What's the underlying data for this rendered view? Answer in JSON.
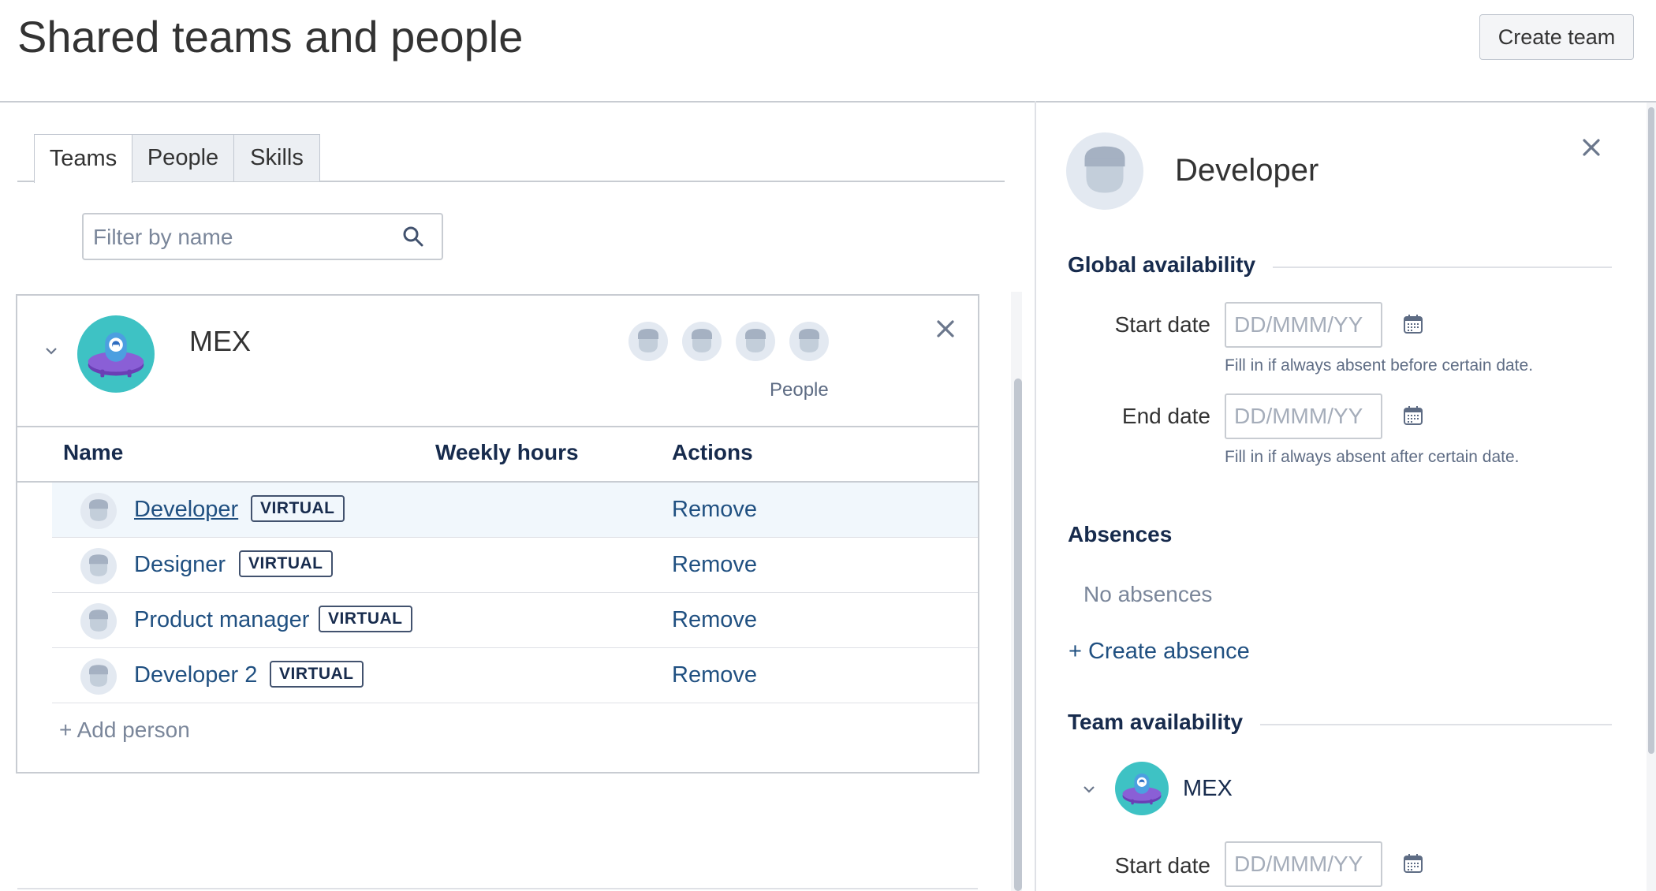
{
  "header": {
    "title": "Shared teams and people",
    "create_team_label": "Create team"
  },
  "tabs": [
    {
      "label": "Teams",
      "active": true
    },
    {
      "label": "People",
      "active": false
    },
    {
      "label": "Skills",
      "active": false
    }
  ],
  "filter": {
    "placeholder": "Filter by name",
    "value": ""
  },
  "team": {
    "name": "MEX",
    "people_label": "People",
    "columns": {
      "name": "Name",
      "weekly_hours": "Weekly hours",
      "actions": "Actions"
    },
    "members": [
      {
        "name": "Developer",
        "badge": "VIRTUAL",
        "weekly_hours": "",
        "action": "Remove",
        "selected": true
      },
      {
        "name": "Designer",
        "badge": "VIRTUAL",
        "weekly_hours": "",
        "action": "Remove",
        "selected": false
      },
      {
        "name": "Product manager",
        "badge": "VIRTUAL",
        "weekly_hours": "",
        "action": "Remove",
        "selected": false
      },
      {
        "name": "Developer 2",
        "badge": "VIRTUAL",
        "weekly_hours": "",
        "action": "Remove",
        "selected": false
      }
    ],
    "add_person_label": "+ Add person"
  },
  "panel": {
    "title": "Developer",
    "global_availability": {
      "heading": "Global availability",
      "start_label": "Start date",
      "start_placeholder": "DD/MMM/YY",
      "start_help": "Fill in if always absent before certain date.",
      "end_label": "End date",
      "end_placeholder": "DD/MMM/YY",
      "end_help": "Fill in if always absent after certain date."
    },
    "absences": {
      "heading": "Absences",
      "empty_text": "No absences",
      "create_label": "+ Create absence"
    },
    "team_availability": {
      "heading": "Team availability",
      "team_name": "MEX",
      "start_label": "Start date",
      "start_placeholder": "DD/MMM/YY"
    }
  },
  "colors": {
    "link": "#205081",
    "team_avatar_bg": "#3ec2c4",
    "team_avatar_purple": "#7b4fc9",
    "person_avatar_bg": "#dfe6f0",
    "row_highlight": "#f1f7fc"
  },
  "icons": [
    "search-icon",
    "chevron-down-icon",
    "close-icon",
    "calendar-icon",
    "team-avatar-icon",
    "person-avatar-icon"
  ]
}
